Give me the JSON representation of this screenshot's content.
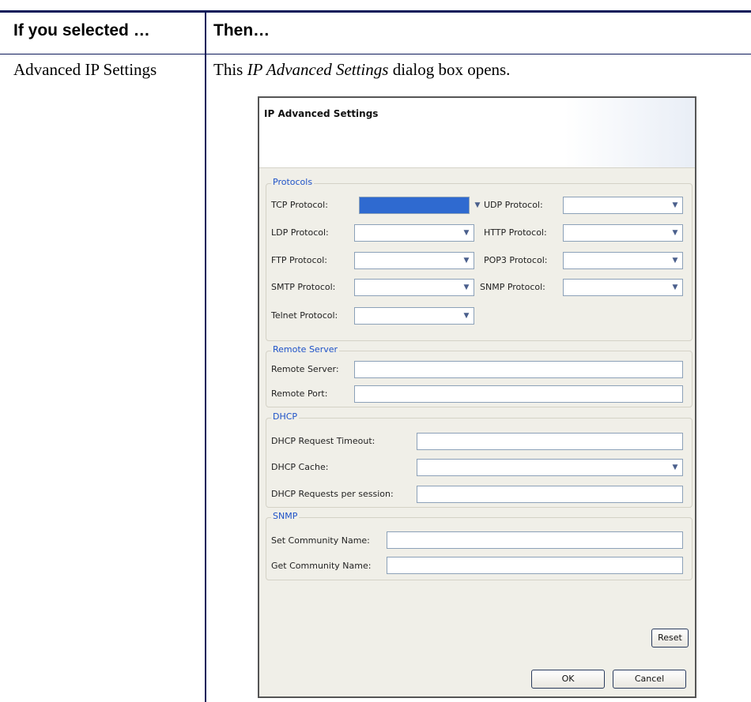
{
  "table": {
    "header_left": "If you selected …",
    "header_right": "Then…",
    "row_left": "Advanced IP Settings",
    "row_right_prefix": "This ",
    "row_right_italic": "IP Advanced Settings",
    "row_right_suffix": " dialog box opens."
  },
  "dialog": {
    "title": "IP Advanced Settings",
    "protocols": {
      "title": "Protocols",
      "tcp": "TCP Protocol:",
      "udp": "UDP Protocol:",
      "ldp": "LDP Protocol:",
      "http": "HTTP Protocol:",
      "ftp": "FTP Protocol:",
      "pop3": "POP3 Protocol:",
      "smtp": "SMTP Protocol:",
      "snmp": "SNMP Protocol:",
      "telnet": "Telnet Protocol:"
    },
    "remote": {
      "title": "Remote Server",
      "server": "Remote Server:",
      "port": "Remote Port:"
    },
    "dhcp": {
      "title": "DHCP",
      "timeout": "DHCP Request Timeout:",
      "cache": "DHCP Cache:",
      "requests": "DHCP Requests per session:"
    },
    "snmp": {
      "title": "SNMP",
      "set": "Set Community Name:",
      "get": "Get Community Name:"
    },
    "buttons": {
      "reset": "Reset",
      "ok": "OK",
      "cancel": "Cancel"
    },
    "icons": {
      "dropdown": "chevron-down-icon"
    },
    "colors": {
      "accent": "#1e52c8",
      "selected_field": "#2f6ad0"
    }
  }
}
